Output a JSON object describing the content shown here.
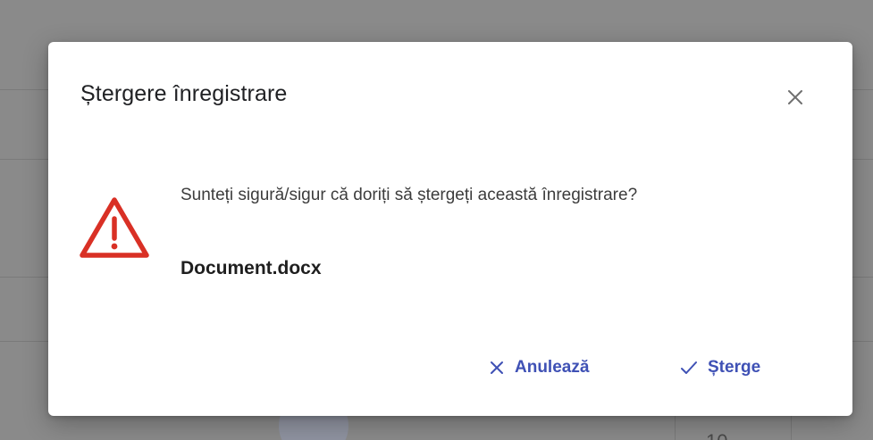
{
  "dialog": {
    "title": "Ștergere înregistrare",
    "message": "Sunteți sigură/sigur că doriți să ștergeți această înregistrare?",
    "filename": "Document.docx",
    "cancel_label": "Anulează",
    "delete_label": "Șterge",
    "accent_color": "#3f51b5",
    "warning_color": "#d93025"
  },
  "background": {
    "page_indicator": "10"
  }
}
